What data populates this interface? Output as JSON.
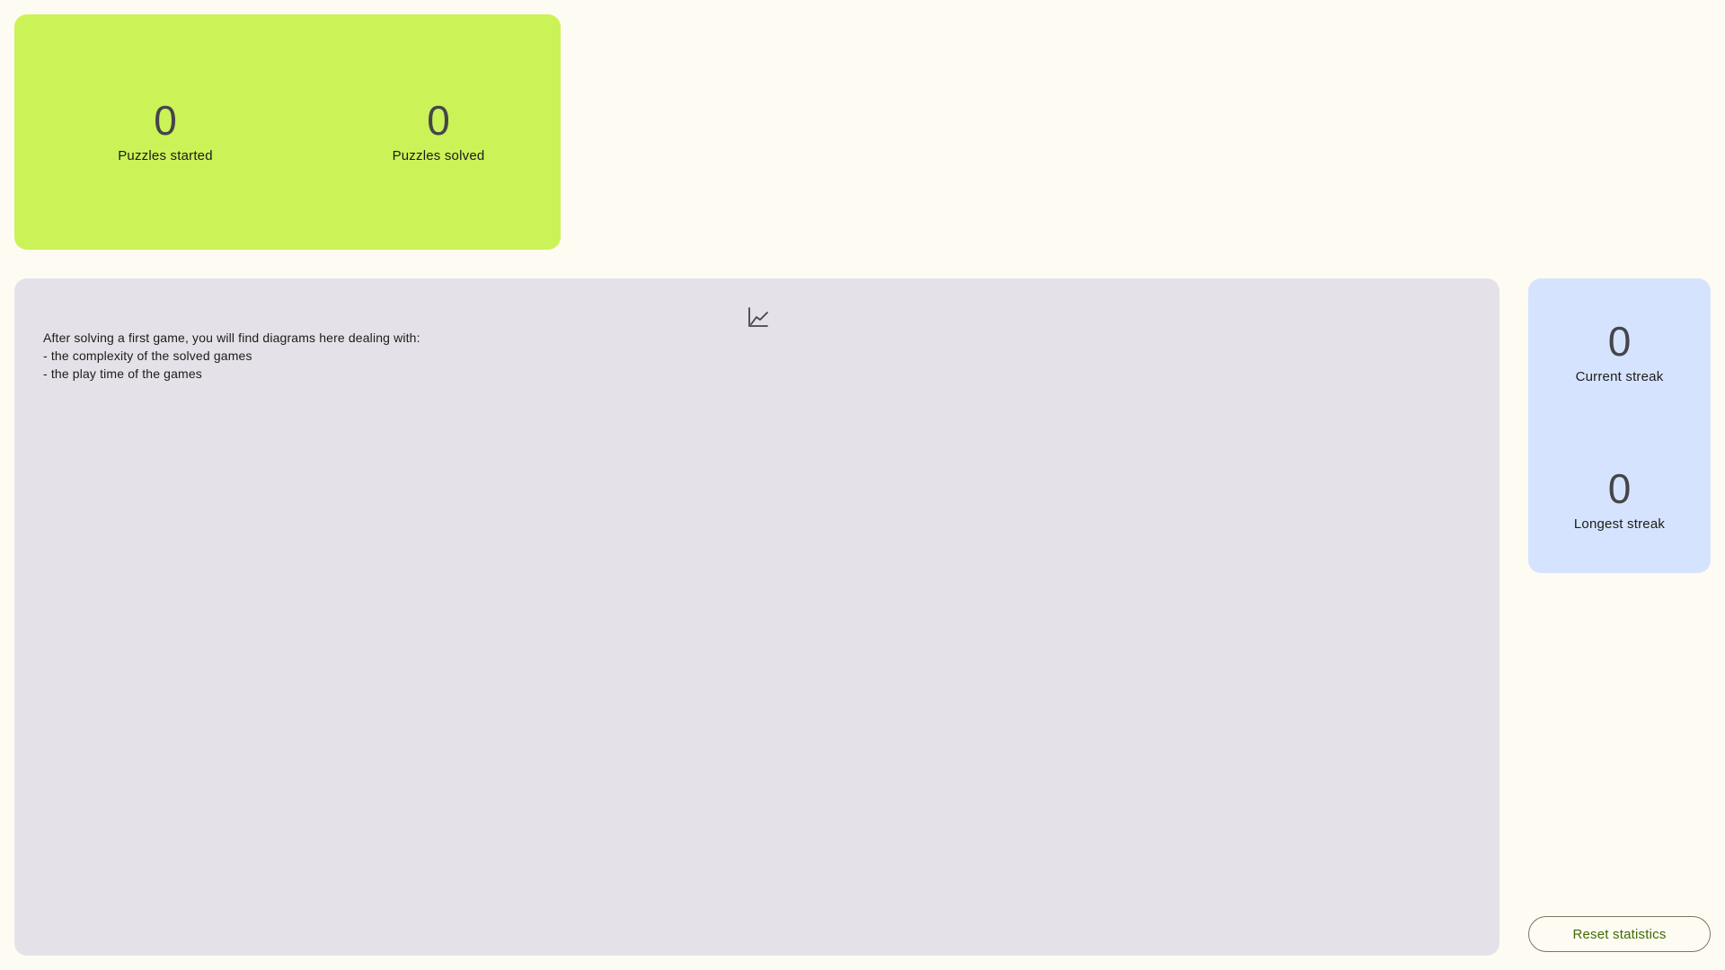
{
  "puzzles": {
    "started_value": "0",
    "started_label": "Puzzles started",
    "solved_value": "0",
    "solved_label": "Puzzles solved"
  },
  "diagrams": {
    "icon": "chart-line-icon",
    "lines": [
      "After solving a first game, you will find diagrams here dealing with:",
      "- the complexity of the solved games",
      "- the play time of the games"
    ]
  },
  "streaks": {
    "current_value": "0",
    "current_label": "Current streak",
    "longest_value": "0",
    "longest_label": "Longest streak"
  },
  "actions": {
    "reset_label": "Reset statistics"
  },
  "colors": {
    "background": "#fefbf3",
    "puzzles_card": "#cbf257",
    "diagram_card": "#e5e1e9",
    "streak_card": "#d6e3ff",
    "accent_text": "#3f6b00"
  }
}
